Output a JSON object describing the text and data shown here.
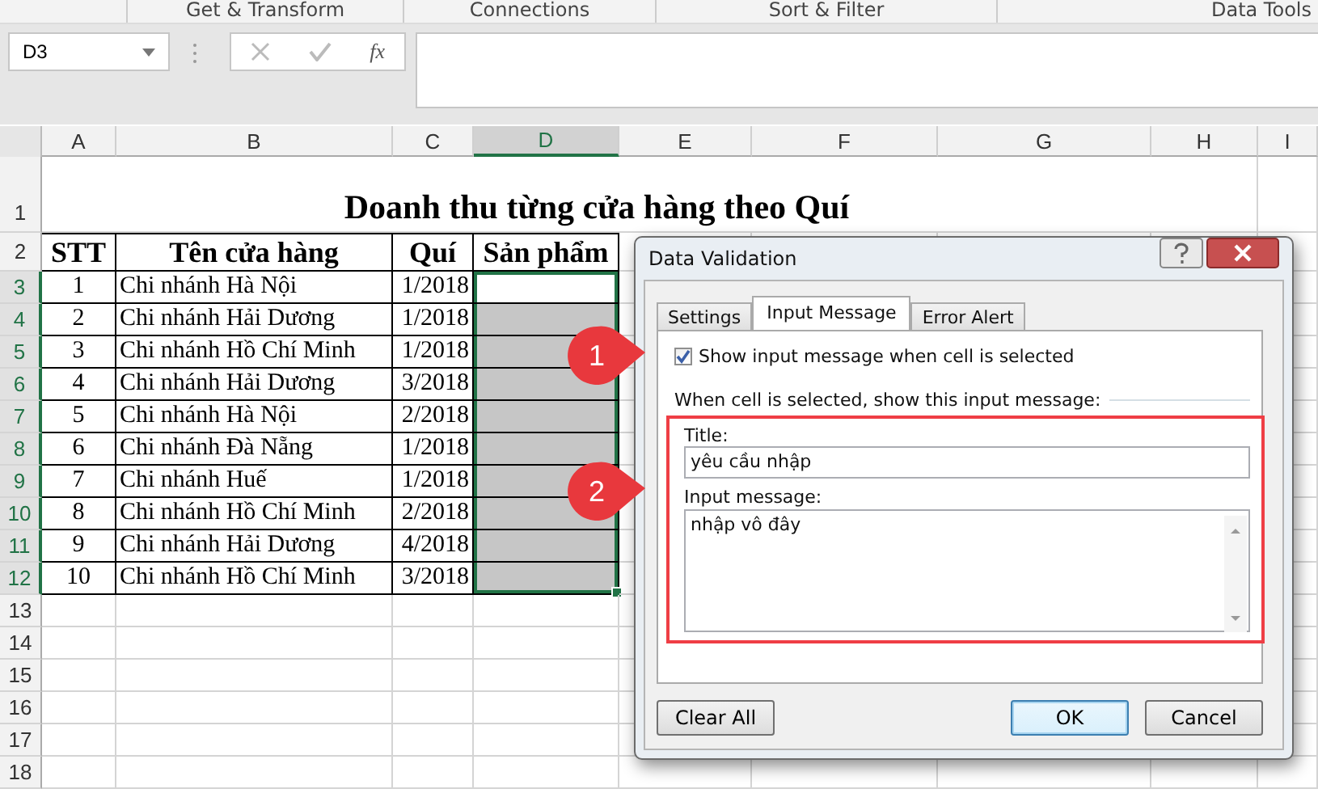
{
  "ribbon_groups": [
    "Get & Transform",
    "Connections",
    "Sort & Filter",
    "Data Tools"
  ],
  "formula_bar": {
    "name_box": "D3",
    "function_label": "fx"
  },
  "columns": [
    {
      "label": "A",
      "selected": false
    },
    {
      "label": "B",
      "selected": false
    },
    {
      "label": "C",
      "selected": false
    },
    {
      "label": "D",
      "selected": true
    },
    {
      "label": "E",
      "selected": false
    },
    {
      "label": "F",
      "selected": false
    },
    {
      "label": "G",
      "selected": false
    },
    {
      "label": "H",
      "selected": false
    },
    {
      "label": "I",
      "selected": false
    }
  ],
  "sheet": {
    "title_row": {
      "number": "1",
      "text": "Doanh thu từng cửa hàng theo Quí"
    },
    "header_row": {
      "number": "2",
      "headers": [
        "STT",
        "Tên cửa hàng",
        "Quí",
        "Sản phẩm"
      ]
    },
    "rows": [
      {
        "number": "3",
        "selected": true,
        "stt": "1",
        "name": "Chi nhánh Hà Nội",
        "quarter": "1/2018",
        "product_cell_active": true
      },
      {
        "number": "4",
        "selected": true,
        "stt": "2",
        "name": "Chi nhánh Hải Dương",
        "quarter": "1/2018",
        "product_cell_active": false
      },
      {
        "number": "5",
        "selected": true,
        "stt": "3",
        "name": "Chi nhánh Hồ Chí Minh",
        "quarter": "1/2018",
        "product_cell_active": false
      },
      {
        "number": "6",
        "selected": true,
        "stt": "4",
        "name": "Chi nhánh Hải Dương",
        "quarter": "3/2018",
        "product_cell_active": false
      },
      {
        "number": "7",
        "selected": true,
        "stt": "5",
        "name": "Chi nhánh Hà Nội",
        "quarter": "2/2018",
        "product_cell_active": false
      },
      {
        "number": "8",
        "selected": true,
        "stt": "6",
        "name": "Chi nhánh Đà Nẵng",
        "quarter": "1/2018",
        "product_cell_active": false
      },
      {
        "number": "9",
        "selected": true,
        "stt": "7",
        "name": "Chi nhánh Huế",
        "quarter": "1/2018",
        "product_cell_active": false
      },
      {
        "number": "10",
        "selected": true,
        "stt": "8",
        "name": "Chi nhánh Hồ Chí Minh",
        "quarter": "2/2018",
        "product_cell_active": false
      },
      {
        "number": "11",
        "selected": true,
        "stt": "9",
        "name": "Chi nhánh Hải Dương",
        "quarter": "4/2018",
        "product_cell_active": false
      },
      {
        "number": "12",
        "selected": true,
        "stt": "10",
        "name": "Chi nhánh Hồ Chí Minh",
        "quarter": "3/2018",
        "product_cell_active": false
      }
    ],
    "empty_rows": [
      "13",
      "14",
      "15",
      "16",
      "17",
      "18"
    ]
  },
  "dialog": {
    "title": "Data Validation",
    "tabs": [
      {
        "label": "Settings",
        "selected": false
      },
      {
        "label": "Input Message",
        "selected": true
      },
      {
        "label": "Error Alert",
        "selected": false
      }
    ],
    "show_message_checkbox": {
      "label": "Show input message when cell is selected",
      "checked": true
    },
    "section_label": "When cell is selected, show this input message:",
    "title_field": {
      "label": "Title:",
      "value": "yêu cầu nhập"
    },
    "message_field": {
      "label": "Input message:",
      "value": "nhập vô đây"
    },
    "buttons": [
      {
        "label": "Clear All",
        "kind": "left"
      },
      {
        "label": "OK",
        "kind": "default"
      },
      {
        "label": "Cancel",
        "kind": "plain"
      }
    ]
  },
  "callouts": [
    {
      "text": "1"
    },
    {
      "text": "2"
    }
  ]
}
